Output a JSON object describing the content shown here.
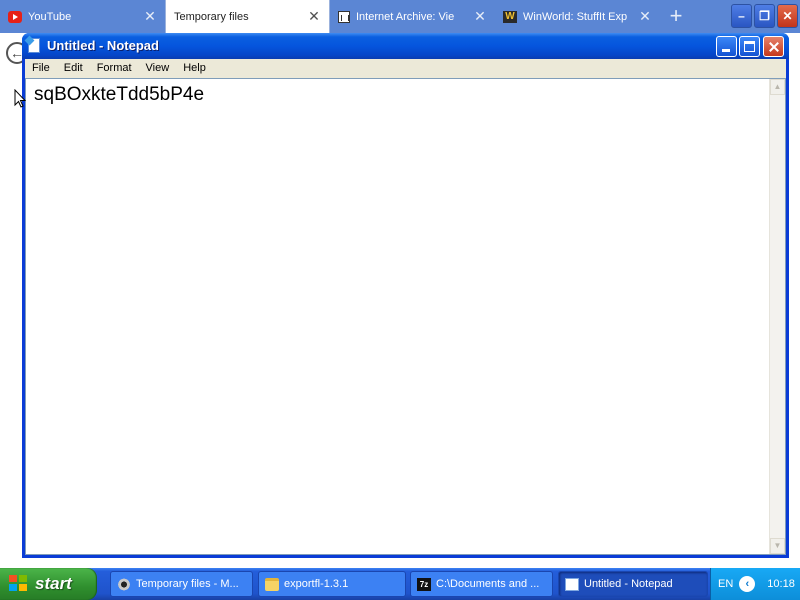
{
  "browser": {
    "tabs": [
      {
        "label": "YouTube",
        "icon": "youtube-icon",
        "active": false
      },
      {
        "label": "Temporary files",
        "icon": "",
        "active": true
      },
      {
        "label": "Internet Archive: Vie",
        "icon": "internet-archive-icon",
        "active": false
      },
      {
        "label": "WinWorld: StuffIt Exp",
        "icon": "winworld-icon",
        "active": false
      }
    ],
    "new_tab_label": "+",
    "winworld_fav": "W"
  },
  "notepad": {
    "title": "Untitled - Notepad",
    "menu": [
      "File",
      "Edit",
      "Format",
      "View",
      "Help"
    ],
    "content": "sqBOxkteTdd5bP4e"
  },
  "taskbar": {
    "start_label": "start",
    "items": [
      {
        "label": "Temporary files - M...",
        "icon": "eye-icon"
      },
      {
        "label": "exportfl-1.3.1",
        "icon": "folder-icon"
      },
      {
        "label": "C:\\Documents and ...",
        "icon": "7zip-icon",
        "icon_text": "7z"
      },
      {
        "label": "Untitled - Notepad",
        "icon": "notepad-icon",
        "active": true
      }
    ],
    "tray": {
      "language": "EN",
      "clock": "10:18"
    }
  },
  "colors": {
    "titlebar": "#0555dd",
    "taskbar": "#245edb",
    "start_button": "#3a9d38",
    "menubar": "#ece9d8"
  }
}
